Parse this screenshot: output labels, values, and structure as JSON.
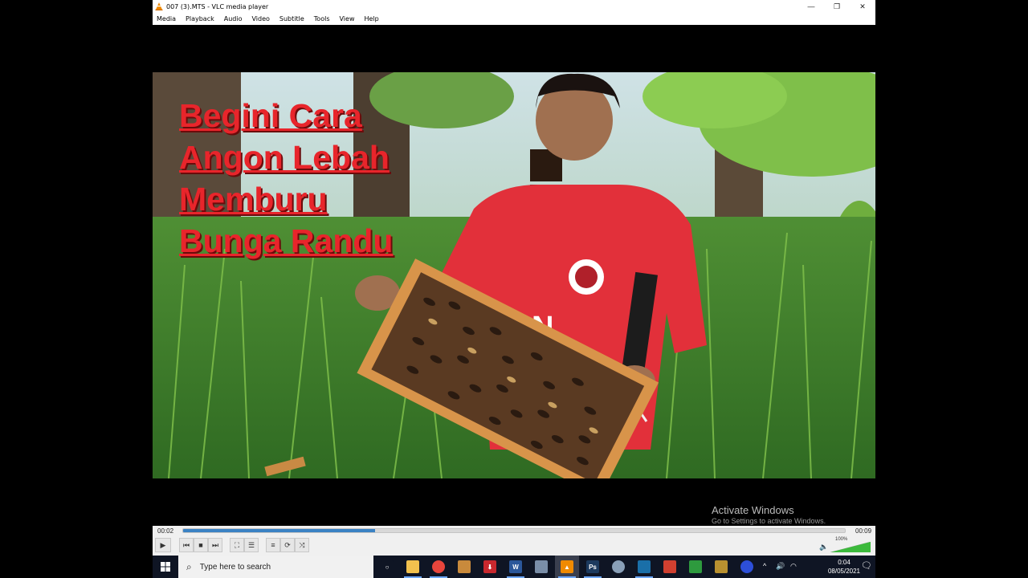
{
  "window": {
    "title": "007 (3).MTS - VLC media player",
    "minimize": "—",
    "restore": "❐",
    "close": "✕"
  },
  "menu": [
    "Media",
    "Playback",
    "Audio",
    "Video",
    "Subtitle",
    "Tools",
    "View",
    "Help"
  ],
  "video": {
    "caption_lines": [
      "Begini Cara",
      "Angon Lebah",
      "Memburu",
      "Bunga Randu"
    ],
    "shirt_text": "AON"
  },
  "watermark": {
    "line1": "Activate Windows",
    "line2": "Go to Settings to activate Windows."
  },
  "player": {
    "time_elapsed": "00:02",
    "time_total": "00:09",
    "progress_fraction": 0.29,
    "volume_percent": "100%",
    "volume_fraction": 1.0,
    "buttons": {
      "play": "▶",
      "prev": "⏮",
      "stop": "■",
      "next": "⏭",
      "fullscreen": "⛶",
      "extended": "☰",
      "playlist": "≡",
      "loop": "⟳",
      "random": "⤨"
    }
  },
  "taskbar": {
    "search_placeholder": "Type here to search",
    "time": "0:04",
    "date": "08/05/2021",
    "notification_count": "1",
    "apps": [
      {
        "name": "task-view",
        "label": "○",
        "color": "#0f1524"
      },
      {
        "name": "file-explorer",
        "label": "",
        "color": "#f2c14e"
      },
      {
        "name": "chrome",
        "label": "",
        "color": "#e8453c"
      },
      {
        "name": "app-orange",
        "label": "",
        "color": "#c98a3c"
      },
      {
        "name": "app-red-download",
        "label": "⬇",
        "color": "#c8282e"
      },
      {
        "name": "word",
        "label": "W",
        "color": "#2b579a"
      },
      {
        "name": "app-grid",
        "label": "",
        "color": "#7a8ea8"
      },
      {
        "name": "vlc",
        "label": "▲",
        "color": "#f08a00"
      },
      {
        "name": "photoshop",
        "label": "Ps",
        "color": "#1c3a5e"
      },
      {
        "name": "app-globe",
        "label": "",
        "color": "#8aa0b8"
      },
      {
        "name": "app-video-editor",
        "label": "",
        "color": "#1a6fa8"
      },
      {
        "name": "app-db",
        "label": "",
        "color": "#d04030"
      },
      {
        "name": "app-green",
        "label": "",
        "color": "#2e9a3e"
      },
      {
        "name": "app-bolt",
        "label": "",
        "color": "#b89030"
      },
      {
        "name": "app-blue-circle",
        "label": "",
        "color": "#2d4fd8"
      }
    ]
  }
}
